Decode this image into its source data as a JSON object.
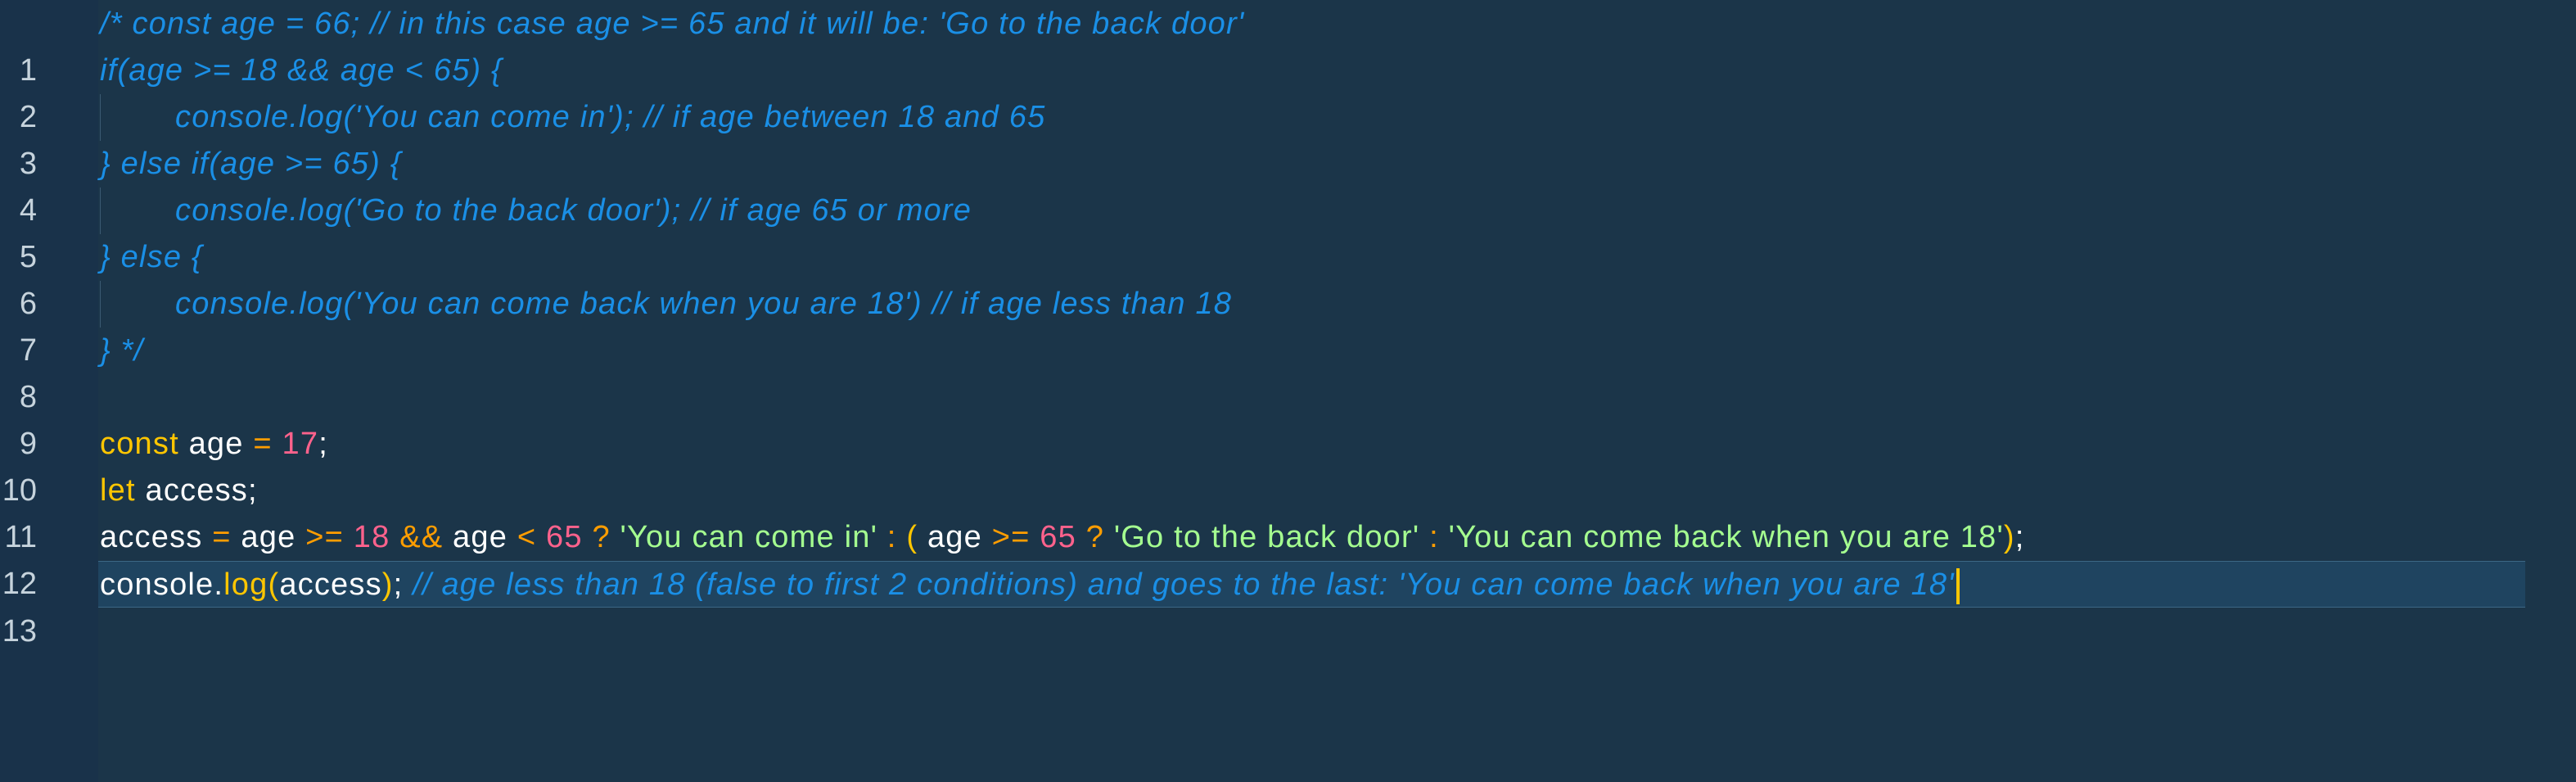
{
  "editor": {
    "colors": {
      "background": "#1b3549",
      "comment": "#1a8fe6",
      "keyword": "#ffc600",
      "number": "#ff628c",
      "string": "#a5ff90",
      "operator": "#ff9d00",
      "cursor": "#ffc600"
    },
    "lines": [
      {
        "number": "1",
        "text": "/* const age = 66; // in this case age >= 65 and it will be: 'Go to the back door'"
      },
      {
        "number": "2",
        "text": "if(age >= 18 && age < 65) {"
      },
      {
        "number": "3",
        "text": "console.log('You can come in'); // if age between 18 and 65"
      },
      {
        "number": "4",
        "text": "} else if(age >= 65) {"
      },
      {
        "number": "5",
        "text": "console.log('Go to the back door'); // if age 65 or more"
      },
      {
        "number": "6",
        "text": "} else {"
      },
      {
        "number": "7",
        "text": "console.log('You can come back when you are 18') // if age less than 18"
      },
      {
        "number": "8",
        "text": "} */"
      },
      {
        "number": "9",
        "text": ""
      },
      {
        "number": "10",
        "tokens": {
          "kw": "const",
          "id": "age",
          "op": "=",
          "num": "17",
          "punc": ";"
        }
      },
      {
        "number": "11",
        "tokens": {
          "kw": "let",
          "id": "access",
          "punc": ";"
        }
      },
      {
        "number": "12",
        "tokens": {
          "t1": "access",
          "t2": "=",
          "t3": "age",
          "t4": ">=",
          "t5": "18",
          "t6": "&&",
          "t7": "age",
          "t8": "<",
          "t9": "65",
          "t10": "?",
          "t11": "'You can come in'",
          "t12": ":",
          "t13": "(",
          "t14": "age",
          "t15": ">=",
          "t16": "65",
          "t17": "?",
          "t18": "'Go to the back door'",
          "t19": ":",
          "t20": "'You can come back when you are 18'",
          "t21": ")",
          "t22": ";"
        }
      },
      {
        "number": "13",
        "tokens": {
          "t1": "console",
          "t2": ".",
          "t3": "log",
          "t4": "(",
          "t5": "access",
          "t6": ")",
          "t7": ";",
          "t8": "// age less than 18 (false to first 2 conditions) and goes to the last: 'You can come back when you are 18'"
        }
      }
    ]
  }
}
